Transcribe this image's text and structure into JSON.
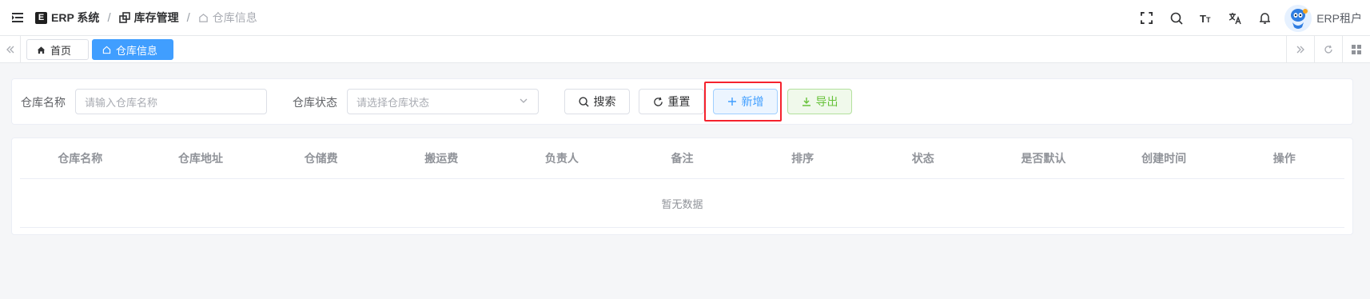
{
  "navbar": {
    "app_name": "ERP 系统",
    "breadcrumb": [
      "库存管理",
      "仓库信息"
    ],
    "user_name": "ERP租户"
  },
  "tags": [
    {
      "label": "首页",
      "icon": "home-icon"
    },
    {
      "label": "仓库信息",
      "icon": "home-outline-icon",
      "active": true
    }
  ],
  "search": {
    "name_label": "仓库名称",
    "name_placeholder": "请输入仓库名称",
    "status_label": "仓库状态",
    "status_placeholder": "请选择仓库状态",
    "search_button": "搜索",
    "reset_button": "重置",
    "add_button": "新增",
    "export_button": "导出"
  },
  "table": {
    "columns": [
      "仓库名称",
      "仓库地址",
      "仓储费",
      "搬运费",
      "负责人",
      "备注",
      "排序",
      "状态",
      "是否默认",
      "创建时间",
      "操作"
    ],
    "empty_text": "暂无数据"
  },
  "colors": {
    "primary": "#409eff",
    "success": "#67c23a",
    "highlight": "#f5222d"
  }
}
